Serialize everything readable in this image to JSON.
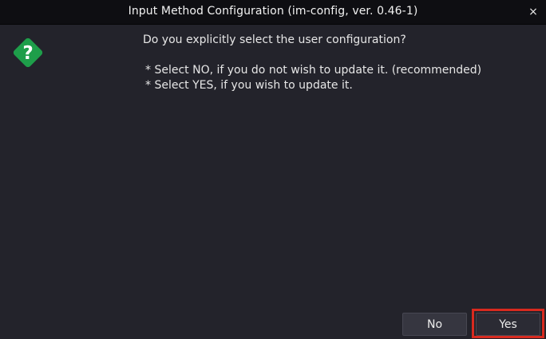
{
  "window": {
    "title": "Input Method Configuration (im-config, ver. 0.46-1)",
    "close_label": "×"
  },
  "dialog": {
    "icon": "question-icon",
    "icon_color": "#1e9e4a",
    "question": "Do you explicitly select the user configuration?",
    "bullets": [
      "* Select NO, if you do not wish to update it. (recommended)",
      "* Select YES, if you wish to update it."
    ]
  },
  "buttons": {
    "no_label": "No",
    "yes_label": "Yes"
  },
  "highlight_color": "#d82a1f"
}
